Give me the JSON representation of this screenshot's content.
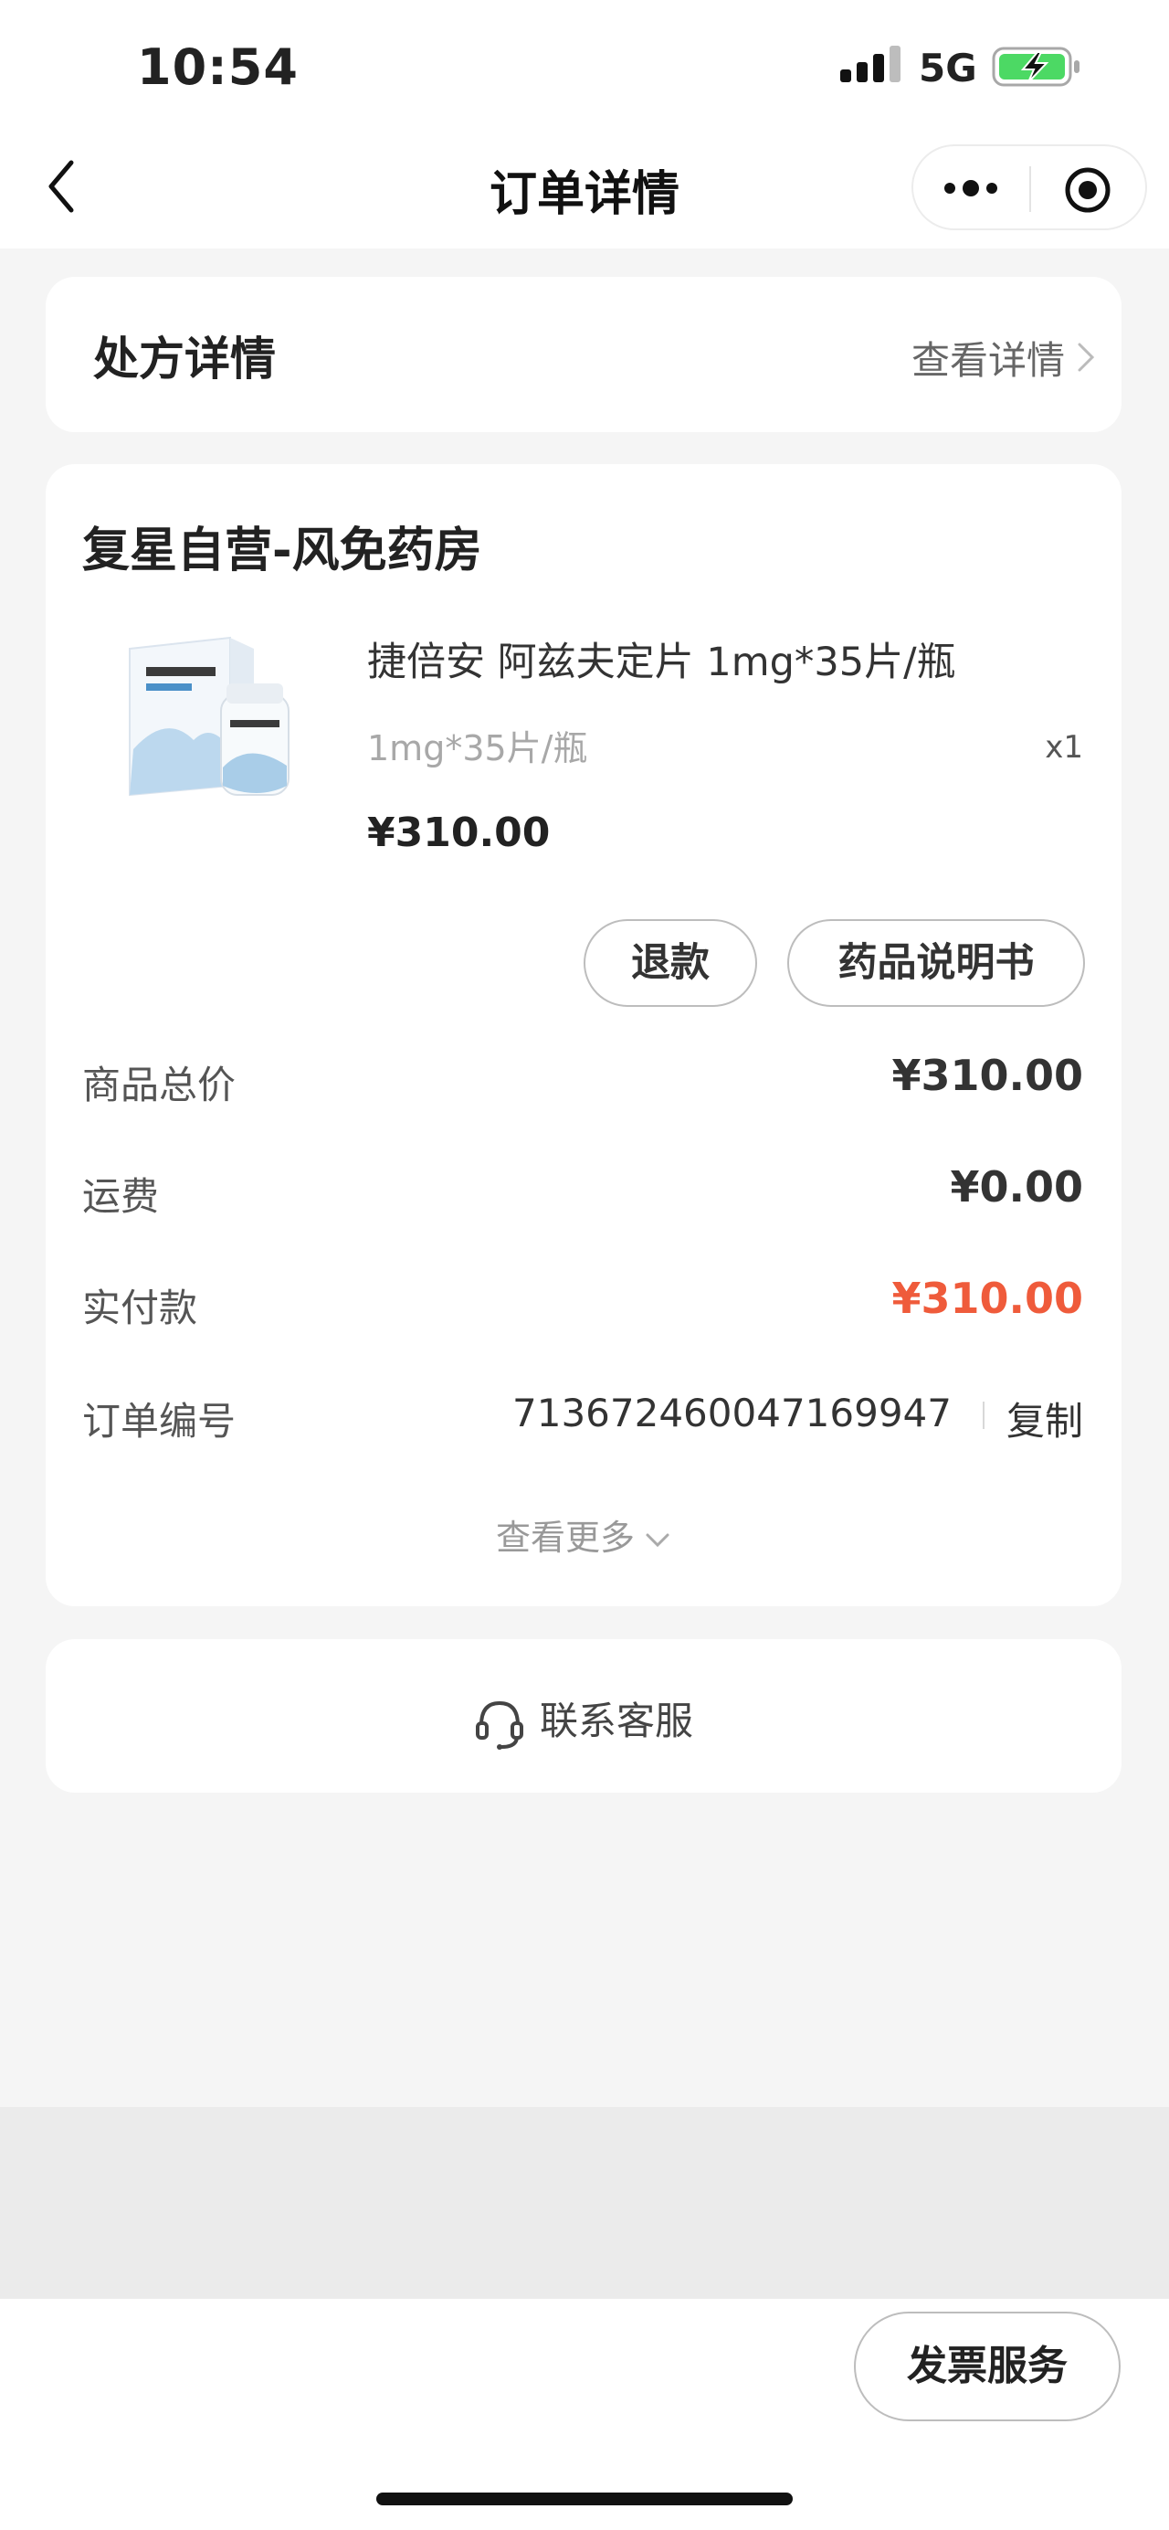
{
  "status_bar": {
    "time": "10:54",
    "network": "5G",
    "signal_icon": "signal-bars-icon",
    "battery_icon": "battery-charging-icon",
    "battery_color": "#4cd964"
  },
  "nav": {
    "title": "订单详情",
    "back_icon": "chevron-left-icon",
    "more_icon": "more-dots-icon",
    "close_icon": "target-close-icon"
  },
  "prescription": {
    "title": "处方详情",
    "link_label": "查看详情"
  },
  "order": {
    "store_name": "复星自营-风免药房",
    "product": {
      "name": "捷倍安 阿兹夫定片 1mg*35片/瓶",
      "spec": "1mg*35片/瓶",
      "quantity": "x1",
      "price": "¥310.00",
      "image_icon": "medicine-box-image"
    },
    "buttons": {
      "refund": "退款",
      "manual": "药品说明书"
    },
    "summary": [
      {
        "label": "商品总价",
        "value": "¥310.00"
      },
      {
        "label": "运费",
        "value": "¥0.00"
      },
      {
        "label": "实付款",
        "value": "¥310.00"
      }
    ],
    "order_number_label": "订单编号",
    "order_number": "713672460047169947",
    "copy_label": "复制",
    "see_more": "查看更多"
  },
  "service": {
    "label": "联系客服",
    "icon": "headset-icon"
  },
  "footer": {
    "invoice_label": "发票服务"
  },
  "colors": {
    "accent_price": "#ef5b3b",
    "background": "#f5f5f5"
  }
}
